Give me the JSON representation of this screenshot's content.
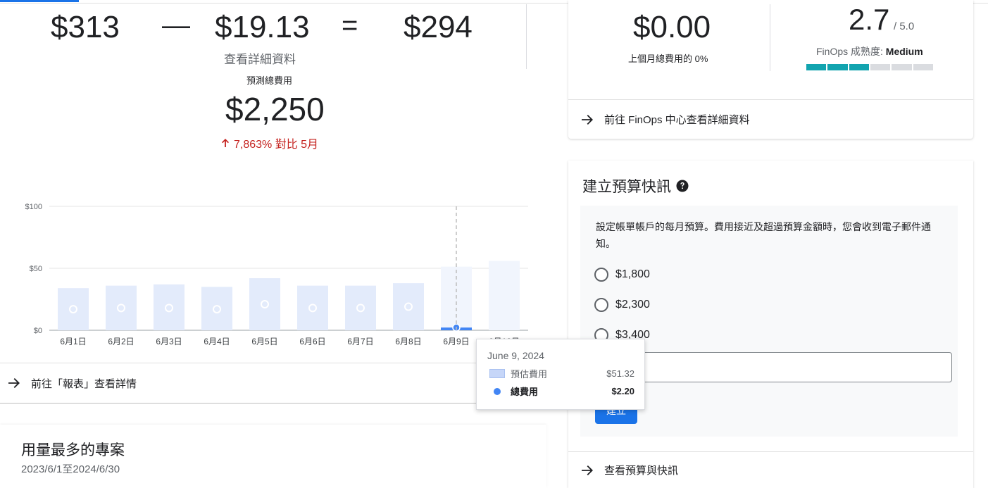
{
  "summary": {
    "actual_cost": "$313",
    "minus_op": "—",
    "savings": "$19.13",
    "equals_op": "=",
    "net_cost": "$294",
    "detail_link": "查看詳細資料",
    "forecast_label": "預測總費用",
    "forecast_value": "$2,250",
    "trend_text": "7,863% 對比 5月",
    "report_link": "前往「報表」查看詳情"
  },
  "chart_data": {
    "type": "bar",
    "categories": [
      "6月1日",
      "6月2日",
      "6月3日",
      "6月4日",
      "6月5日",
      "6月6日",
      "6月7日",
      "6月8日",
      "6月9日",
      "6月10日"
    ],
    "y_ticks": [
      "$0",
      "$50",
      "$100"
    ],
    "ylim": [
      0,
      100
    ],
    "series": [
      {
        "name": "預估費用",
        "values": [
          34,
          36,
          37,
          35,
          42,
          36,
          36,
          38,
          51.32,
          56
        ]
      },
      {
        "name": "總費用",
        "values": [
          17,
          18,
          18,
          17,
          21,
          18,
          18,
          19,
          2.2,
          null
        ]
      }
    ],
    "highlight_index": 8,
    "colors": {
      "forecast": "#e3ebfb",
      "forecast_future": "#f1f5fd",
      "total": "#4285f4",
      "grid": "#e6e6e6"
    }
  },
  "tooltip": {
    "date": "June 9, 2024",
    "forecast_label": "預估費用",
    "forecast_value": "$51.32",
    "total_label": "總費用",
    "total_value": "$2.20"
  },
  "projects": {
    "title": "用量最多的專案",
    "range": "2023/6/1至2024/6/30"
  },
  "finops": {
    "savings_value": "$0.00",
    "savings_pct": "上個月總費用的 0%",
    "score": "2.7",
    "score_max": "/ 5.0",
    "maturity_label": "FinOps 成熟度:",
    "maturity_level": "Medium",
    "maturity_fraction": 0.5,
    "link": "前往 FinOps 中心查看詳細資料"
  },
  "budget": {
    "title": "建立預算快訊",
    "description": "設定帳單帳戶的每月預算。費用接近及超過預算金額時，您會收到電子郵件通知。",
    "options": [
      "$1,800",
      "$2,300",
      "$3,400"
    ],
    "create_button": "建立",
    "link": "查看預算與快訊"
  }
}
